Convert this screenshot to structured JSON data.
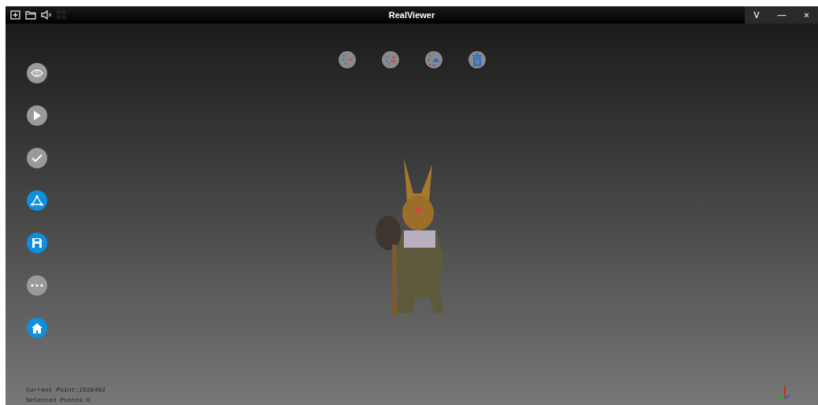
{
  "window": {
    "title": "RealViewer",
    "controls": [
      "V",
      "—",
      "×"
    ]
  },
  "toolbar_icons": [
    {
      "kind": "new",
      "disabled": false
    },
    {
      "kind": "open",
      "disabled": false
    },
    {
      "kind": "sound",
      "disabled": false
    },
    {
      "kind": "grid",
      "disabled": true
    }
  ],
  "top_tools": [
    {
      "kind": "select-all"
    },
    {
      "kind": "select-invert"
    },
    {
      "kind": "points"
    },
    {
      "kind": "delete"
    }
  ],
  "sidebar": [
    {
      "kind": "view",
      "enabled": false
    },
    {
      "kind": "play",
      "enabled": false
    },
    {
      "kind": "confirm",
      "enabled": false
    },
    {
      "kind": "mesh",
      "enabled": true
    },
    {
      "kind": "save",
      "enabled": true
    },
    {
      "kind": "more",
      "enabled": false
    },
    {
      "kind": "home",
      "enabled": true
    }
  ],
  "status": [
    "Current Point:1628492",
    "Selected Points:0"
  ]
}
